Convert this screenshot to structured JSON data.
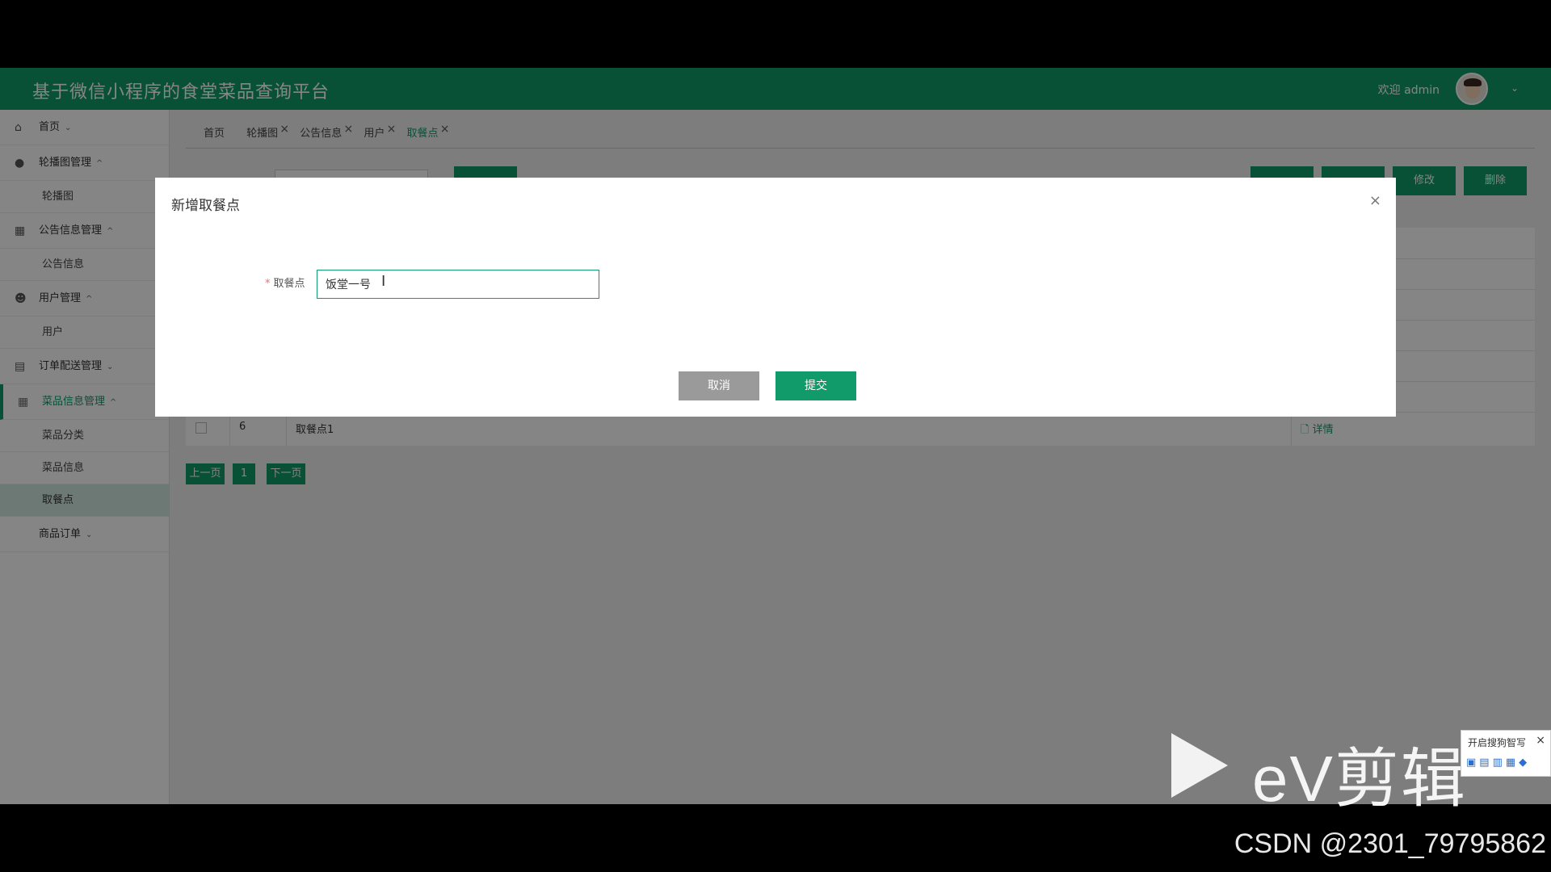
{
  "header": {
    "title": "基于微信小程序的食堂菜品查询平台",
    "welcome": "欢迎 admin"
  },
  "sidebar": {
    "items": [
      {
        "label": "首页"
      },
      {
        "label": "轮播图管理"
      },
      {
        "label": "轮播图"
      },
      {
        "label": "公告信息管理"
      },
      {
        "label": "公告信息"
      },
      {
        "label": "用户管理"
      },
      {
        "label": "用户"
      },
      {
        "label": "订单配送管理"
      },
      {
        "label": "菜品信息管理"
      },
      {
        "label": "菜品分类"
      },
      {
        "label": "菜品信息"
      },
      {
        "label": "取餐点"
      },
      {
        "label": "商品订单"
      }
    ]
  },
  "tabs": [
    {
      "label": "首页"
    },
    {
      "label": "轮播图"
    },
    {
      "label": "公告信息"
    },
    {
      "label": "用户"
    },
    {
      "label": "取餐点"
    }
  ],
  "toolbar": {
    "edit": "修改",
    "delete": "删除"
  },
  "table": {
    "rows": [
      {
        "id": "6",
        "name": "取餐点1",
        "action": "详情"
      }
    ]
  },
  "pager": {
    "prev": "上一页",
    "page": "1",
    "next": "下一页"
  },
  "dialog": {
    "title": "新增取餐点",
    "field_label": "取餐点",
    "field_value": "饭堂一号",
    "cancel": "取消",
    "submit": "提交"
  },
  "overlay": {
    "ime_title": "开启搜狗智写",
    "watermark": "CSDN @2301_79795862"
  }
}
